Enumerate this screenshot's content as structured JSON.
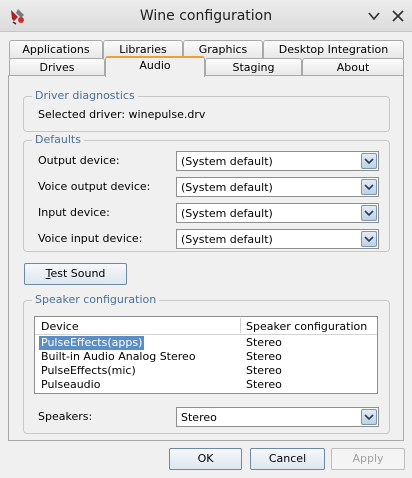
{
  "window": {
    "title": "Wine configuration"
  },
  "tabs_row1": [
    {
      "label": "Applications"
    },
    {
      "label": "Libraries"
    },
    {
      "label": "Graphics"
    },
    {
      "label": "Desktop Integration"
    }
  ],
  "tabs_row2": [
    {
      "label": "Drives"
    },
    {
      "label": "Audio",
      "active": true
    },
    {
      "label": "Staging"
    },
    {
      "label": "About"
    }
  ],
  "driver_diagnostics": {
    "title": "Driver diagnostics",
    "selected_driver": "Selected driver: winepulse.drv"
  },
  "defaults": {
    "title": "Defaults",
    "rows": [
      {
        "label": "Output device:",
        "value": "(System default)"
      },
      {
        "label": "Voice output device:",
        "value": "(System default)"
      },
      {
        "label": "Input device:",
        "value": "(System default)"
      },
      {
        "label": "Voice input device:",
        "value": "(System default)"
      }
    ]
  },
  "test_sound": {
    "label": "Test Sound",
    "mnemonic_first": "T",
    "rest": "est Sound"
  },
  "speaker_configuration": {
    "title": "Speaker configuration",
    "columns": [
      "Device",
      "Speaker configuration"
    ],
    "rows": [
      {
        "device": "PulseEffects(apps)",
        "config": "Stereo",
        "selected": true
      },
      {
        "device": "Built-in Audio Analog Stereo",
        "config": "Stereo"
      },
      {
        "device": "PulseEffects(mic)",
        "config": "Stereo"
      },
      {
        "device": "Pulseaudio",
        "config": "Stereo"
      }
    ],
    "speakers_label": "Speakers:",
    "speakers_value": "Stereo"
  },
  "footer": {
    "ok": "OK",
    "cancel": "Cancel",
    "apply": "Apply"
  },
  "colors": {
    "accent_tab": "#f0a030",
    "group_title": "#4a6f95",
    "selection": "#5c8ec6"
  }
}
